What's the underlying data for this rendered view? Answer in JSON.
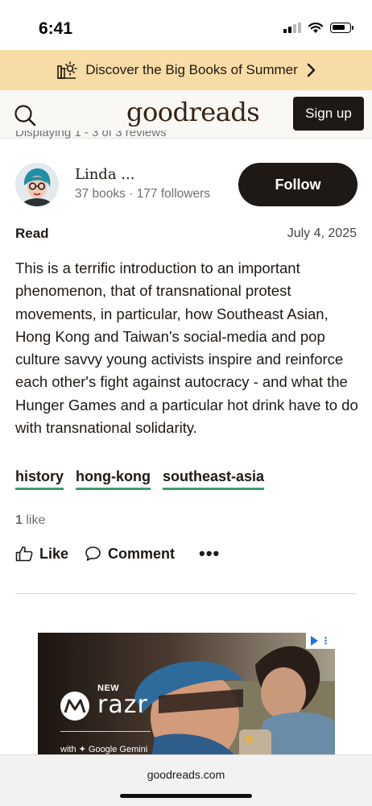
{
  "status_bar": {
    "time": "6:41"
  },
  "promo": {
    "text": "Discover the Big Books of Summer"
  },
  "header": {
    "logo": "goodreads",
    "signup_label": "Sign up"
  },
  "displaying": "Displaying 1 - 3 of 3 reviews",
  "reviewer": {
    "name": "Linda ...",
    "stats": "37 books · 177 followers",
    "follow_label": "Follow"
  },
  "review": {
    "shelf": "Read",
    "date": "July 4, 2025",
    "text": "This is a terrific introduction to an important phenomenon, that of transnational protest movements, in particular, how Southeast Asian, Hong Kong and Taiwan's social-media and pop culture savvy young activists inspire and reinforce each other's fight against autocracy - and what the Hunger Games and a particular hot drink have to do with transnational solidarity.",
    "tags": [
      "history",
      "hong-kong",
      "southeast-asia"
    ],
    "likes_number": "1",
    "likes_word": "like"
  },
  "actions": {
    "like_label": "Like",
    "comment_label": "Comment",
    "more_label": "•••"
  },
  "ad": {
    "new_label": "NEW",
    "brand": "razr",
    "with_label": "with ✦ Google Gemini"
  },
  "browser": {
    "url": "goodreads.com"
  },
  "colors": {
    "promo_bg": "#f8dca5",
    "dark": "#1e1915",
    "tag_underline": "#409d69",
    "logo_brown": "#382110"
  },
  "icons": {
    "signal": "signal-icon",
    "wifi": "wifi-icon",
    "battery": "battery-icon",
    "promo": "sun-books-icon",
    "search": "search-icon",
    "chevron": "chevron-right-icon",
    "like": "thumbs-up-icon",
    "comment": "comment-icon",
    "more": "more-icon"
  }
}
